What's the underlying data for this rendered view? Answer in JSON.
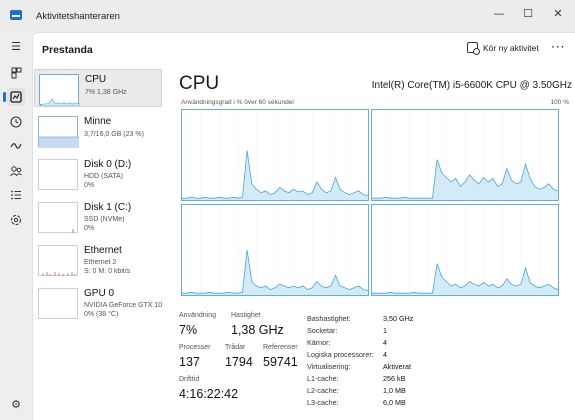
{
  "app": {
    "title": "Aktivitetshanteraren"
  },
  "window_controls": {
    "minimize": "—",
    "maximize": "☐",
    "close": "✕"
  },
  "nav": {
    "icons": [
      "menu-icon",
      "processes-icon",
      "performance-icon",
      "history-icon",
      "startup-icon",
      "users-icon",
      "details-icon",
      "services-icon",
      "settings-icon"
    ]
  },
  "header": {
    "title": "Prestanda",
    "run_task": "Kör ny aktivitet",
    "more": "···"
  },
  "devices": [
    {
      "name": "CPU",
      "lines": [
        "7% 1,38 GHz"
      ]
    },
    {
      "name": "Minne",
      "lines": [
        "3,7/16,0 GB (23 %)"
      ]
    },
    {
      "name": "Disk 0 (D:)",
      "lines": [
        "HDD (SATA)",
        "0%"
      ]
    },
    {
      "name": "Disk 1 (C:)",
      "lines": [
        "SSD (NVMe)",
        "0%"
      ]
    },
    {
      "name": "Ethernet",
      "lines": [
        "Ethernet 2",
        "S: 0 M: 0 kbit/s"
      ]
    },
    {
      "name": "GPU 0",
      "lines": [
        "NVIDIA GeForce GTX 10",
        "0% (38 °C)"
      ]
    }
  ],
  "detail": {
    "title": "CPU",
    "model": "Intel(R) Core(TM) i5-6600K CPU @ 3.50GHz",
    "graph_label": "Användningsgrad i % över 60 sekunder",
    "graph_max": "100 %",
    "cores_graph_data": [
      [
        2,
        2,
        3,
        2,
        2,
        3,
        2,
        2,
        3,
        2,
        2,
        3,
        2,
        3,
        55,
        18,
        12,
        8,
        10,
        6,
        8,
        14,
        10,
        8,
        12,
        9,
        10,
        6,
        8,
        20,
        12,
        8,
        10,
        25,
        12,
        8,
        6,
        8,
        10,
        6,
        5
      ],
      [
        2,
        2,
        2,
        3,
        2,
        2,
        2,
        3,
        2,
        2,
        2,
        2,
        2,
        2,
        45,
        30,
        25,
        20,
        24,
        15,
        20,
        28,
        22,
        18,
        25,
        20,
        24,
        15,
        18,
        35,
        22,
        18,
        20,
        40,
        24,
        15,
        12,
        14,
        18,
        12,
        10
      ],
      [
        2,
        2,
        3,
        2,
        2,
        2,
        3,
        2,
        2,
        2,
        3,
        2,
        2,
        3,
        50,
        15,
        10,
        8,
        10,
        6,
        8,
        12,
        10,
        8,
        10,
        8,
        10,
        6,
        8,
        15,
        10,
        8,
        10,
        22,
        10,
        8,
        6,
        8,
        10,
        6,
        5
      ],
      [
        2,
        2,
        2,
        2,
        3,
        2,
        2,
        2,
        2,
        3,
        2,
        2,
        2,
        2,
        35,
        20,
        15,
        10,
        12,
        8,
        10,
        15,
        12,
        10,
        14,
        10,
        12,
        8,
        10,
        18,
        12,
        10,
        12,
        30,
        14,
        10,
        8,
        10,
        12,
        8,
        6
      ]
    ],
    "stats": {
      "usage_label": "Användning",
      "usage": "7%",
      "speed_label": "Hastighet",
      "speed": "1,38 GHz",
      "processes_label": "Processer",
      "processes": "137",
      "threads_label": "Trådar",
      "threads": "1794",
      "handles_label": "Referenser",
      "handles": "59741",
      "uptime_label": "Drifttid",
      "uptime": "4:16:22:42"
    },
    "info": [
      {
        "key": "Bashastighet:",
        "value": "3,50 GHz"
      },
      {
        "key": "Socketar:",
        "value": "1"
      },
      {
        "key": "Kärnor:",
        "value": "4"
      },
      {
        "key": "Logiska processorer:",
        "value": "4"
      },
      {
        "key": "Virtualisering:",
        "value": "Aktiverat"
      },
      {
        "key": "L1-cache:",
        "value": "256 kB"
      },
      {
        "key": "L2-cache:",
        "value": "1,0 MB"
      },
      {
        "key": "L3-cache:",
        "value": "6,0 MB"
      }
    ]
  },
  "colors": {
    "graph_fill": "#d3ebf7",
    "graph_line": "#4ea3d4",
    "accent": "#1f6fcf"
  }
}
